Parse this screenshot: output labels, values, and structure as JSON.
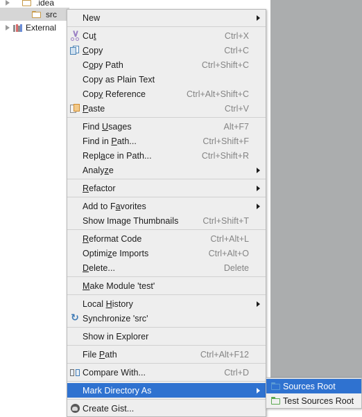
{
  "tree": {
    "items": [
      {
        "label": ".idea",
        "icon": "folder-icon",
        "expandable": true,
        "selected": false,
        "indent": 1
      },
      {
        "label": "src",
        "icon": "folder-icon",
        "expandable": false,
        "selected": true,
        "indent": 2
      },
      {
        "label": "External",
        "icon": "library-icon",
        "expandable": true,
        "selected": false,
        "indent": 0
      }
    ]
  },
  "context_menu": {
    "groups": [
      {
        "items": [
          {
            "label": "New",
            "mnemonic": "",
            "accel": "",
            "icon": "",
            "submenu": true,
            "selected": false
          }
        ]
      },
      {
        "items": [
          {
            "label": "Cut",
            "mnemonic": "t",
            "accel": "Ctrl+X",
            "icon": "cut-icon",
            "submenu": false,
            "selected": false
          },
          {
            "label": "Copy",
            "mnemonic": "C",
            "accel": "Ctrl+C",
            "icon": "copy-icon",
            "submenu": false,
            "selected": false
          },
          {
            "label": "Copy Path",
            "mnemonic": "o",
            "accel": "Ctrl+Shift+C",
            "icon": "",
            "submenu": false,
            "selected": false
          },
          {
            "label": "Copy as Plain Text",
            "mnemonic": "",
            "accel": "",
            "icon": "",
            "submenu": false,
            "selected": false
          },
          {
            "label": "Copy Reference",
            "mnemonic": "y",
            "accel": "Ctrl+Alt+Shift+C",
            "icon": "",
            "submenu": false,
            "selected": false
          },
          {
            "label": "Paste",
            "mnemonic": "P",
            "accel": "Ctrl+V",
            "icon": "paste-icon",
            "submenu": false,
            "selected": false
          }
        ]
      },
      {
        "items": [
          {
            "label": "Find Usages",
            "mnemonic": "U",
            "accel": "Alt+F7",
            "icon": "",
            "submenu": false,
            "selected": false
          },
          {
            "label": "Find in Path...",
            "mnemonic": "P",
            "accel": "Ctrl+Shift+F",
            "icon": "",
            "submenu": false,
            "selected": false
          },
          {
            "label": "Replace in Path...",
            "mnemonic": "a",
            "accel": "Ctrl+Shift+R",
            "icon": "",
            "submenu": false,
            "selected": false
          },
          {
            "label": "Analyze",
            "mnemonic": "z",
            "accel": "",
            "icon": "",
            "submenu": true,
            "selected": false
          }
        ]
      },
      {
        "items": [
          {
            "label": "Refactor",
            "mnemonic": "R",
            "accel": "",
            "icon": "",
            "submenu": true,
            "selected": false
          }
        ]
      },
      {
        "items": [
          {
            "label": "Add to Favorites",
            "mnemonic": "a",
            "accel": "",
            "icon": "",
            "submenu": true,
            "selected": false
          },
          {
            "label": "Show Image Thumbnails",
            "mnemonic": "",
            "accel": "Ctrl+Shift+T",
            "icon": "",
            "submenu": false,
            "selected": false
          }
        ]
      },
      {
        "items": [
          {
            "label": "Reformat Code",
            "mnemonic": "R",
            "accel": "Ctrl+Alt+L",
            "icon": "",
            "submenu": false,
            "selected": false
          },
          {
            "label": "Optimize Imports",
            "mnemonic": "z",
            "accel": "Ctrl+Alt+O",
            "icon": "",
            "submenu": false,
            "selected": false
          },
          {
            "label": "Delete...",
            "mnemonic": "D",
            "accel": "Delete",
            "icon": "",
            "submenu": false,
            "selected": false
          }
        ]
      },
      {
        "items": [
          {
            "label": "Make Module 'test'",
            "mnemonic": "M",
            "accel": "",
            "icon": "",
            "submenu": false,
            "selected": false
          }
        ]
      },
      {
        "items": [
          {
            "label": "Local History",
            "mnemonic": "H",
            "accel": "",
            "icon": "",
            "submenu": true,
            "selected": false
          },
          {
            "label": "Synchronize 'src'",
            "mnemonic": "",
            "accel": "",
            "icon": "sync-icon",
            "submenu": false,
            "selected": false
          }
        ]
      },
      {
        "items": [
          {
            "label": "Show in Explorer",
            "mnemonic": "",
            "accel": "",
            "icon": "",
            "submenu": false,
            "selected": false
          }
        ]
      },
      {
        "items": [
          {
            "label": "File Path",
            "mnemonic": "P",
            "accel": "Ctrl+Alt+F12",
            "icon": "",
            "submenu": false,
            "selected": false
          }
        ]
      },
      {
        "items": [
          {
            "label": "Compare With...",
            "mnemonic": "",
            "accel": "Ctrl+D",
            "icon": "compare-icon",
            "submenu": false,
            "selected": false
          }
        ]
      },
      {
        "items": [
          {
            "label": "Mark Directory As",
            "mnemonic": "",
            "accel": "",
            "icon": "",
            "submenu": true,
            "selected": true
          }
        ]
      },
      {
        "items": [
          {
            "label": "Create Gist...",
            "mnemonic": "",
            "accel": "",
            "icon": "gist-icon",
            "submenu": false,
            "selected": false
          }
        ]
      }
    ]
  },
  "submenu": {
    "items": [
      {
        "label": "Sources Root",
        "icon": "folder-blue-icon",
        "selected": true
      },
      {
        "label": "Test Sources Root",
        "icon": "folder-green-icon",
        "selected": false
      },
      {
        "label": "",
        "icon": "folder-orange-icon",
        "selected": false
      }
    ]
  },
  "colors": {
    "menu_bg": "#eeeeee",
    "menu_border": "#b8b8b8",
    "selection": "#2f72d0",
    "accel_text": "#848484",
    "tree_selection": "#d6d6d6",
    "desktop_gray": "#abadae",
    "folder_orange": "#c69845",
    "folder_blue": "#5b9bd5",
    "folder_green": "#5aa84f"
  }
}
